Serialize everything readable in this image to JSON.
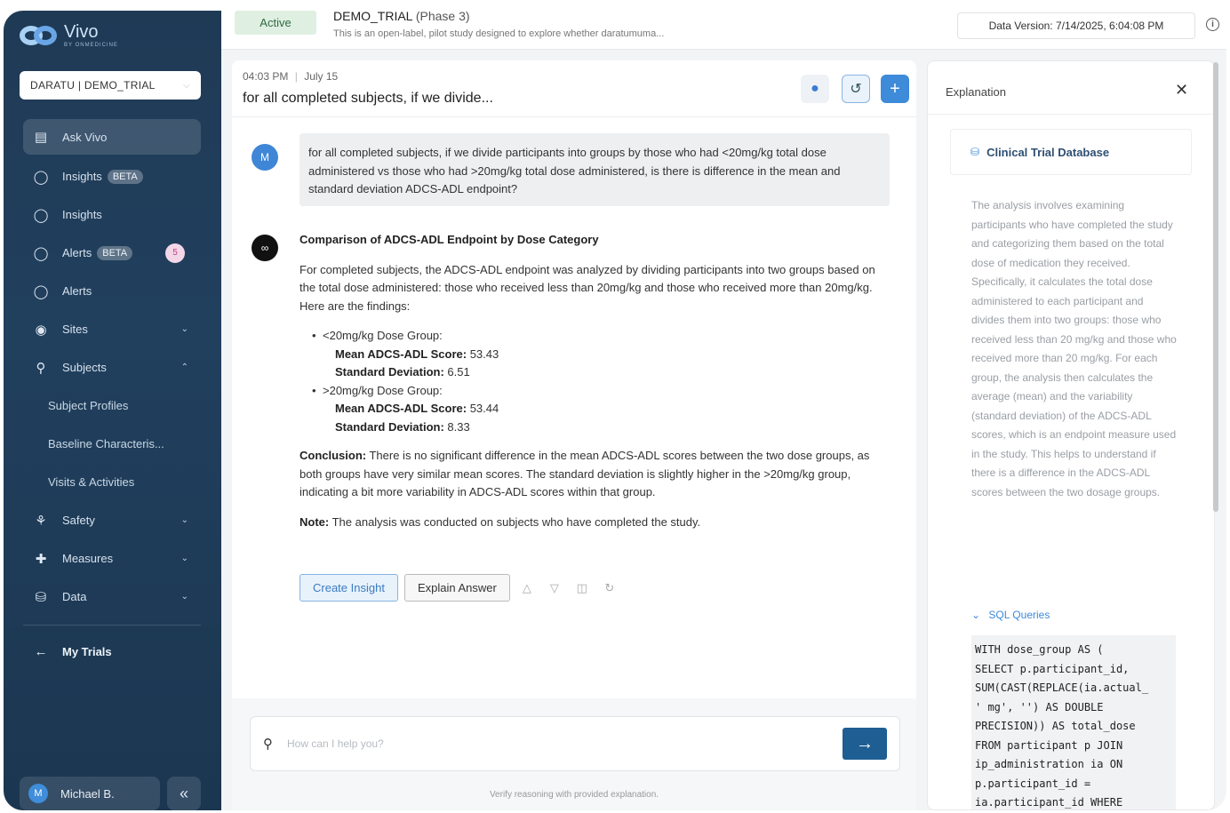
{
  "brand": {
    "name": "Vivo",
    "sub": "BY ONMEDICINE"
  },
  "trial_selector": {
    "value": "DARATU | DEMO_TRIAL"
  },
  "sidebar": {
    "items": [
      {
        "label": "Ask Vivo",
        "icon": "chat-icon"
      },
      {
        "label": "Insights",
        "icon": "lightbulb-icon",
        "badge": "BETA"
      },
      {
        "label": "Insights",
        "icon": "lightbulb-icon"
      },
      {
        "label": "Alerts",
        "icon": "shield-icon",
        "badge": "BETA",
        "count": "5"
      },
      {
        "label": "Alerts",
        "icon": "shield-icon"
      },
      {
        "label": "Sites",
        "icon": "location-icon"
      },
      {
        "label": "Subjects",
        "icon": "search-person-icon"
      }
    ],
    "subjects_children": [
      "Subject Profiles",
      "Baseline Characteris...",
      "Visits & Activities"
    ],
    "items_after": [
      {
        "label": "Safety",
        "icon": "hands-icon"
      },
      {
        "label": "Measures",
        "icon": "medkit-icon"
      },
      {
        "label": "Data",
        "icon": "database-icon"
      }
    ],
    "my_trials": "My Trials",
    "user": {
      "initial": "M",
      "name": "Michael B."
    }
  },
  "header": {
    "status": "Active",
    "study_name": "DEMO_TRIAL",
    "phase": "(Phase 3)",
    "description": "This is an open-label, pilot study designed to explore whether daratumuma...",
    "data_version": "Data Version: 7/14/2025, 6:04:08 PM"
  },
  "chat": {
    "time": "04:03 PM",
    "date": "July 15",
    "title": "for all completed subjects, if we divide...",
    "user_initial": "M",
    "user_message": "for all completed subjects, if we divide participants into groups by those who had <20mg/kg total dose administered vs those who had >20mg/kg total dose administered, is there is difference in the mean and standard deviation ADCS-ADL endpoint?",
    "answer": {
      "heading": "Comparison of ADCS-ADL Endpoint by Dose Category",
      "intro": "For completed subjects, the ADCS-ADL endpoint was analyzed by dividing participants into two groups based on the total dose administered: those who received less than 20mg/kg and those who received more than 20mg/kg. Here are the findings:",
      "groups": [
        {
          "name": "<20mg/kg Dose Group:",
          "mean_label": "Mean ADCS-ADL Score:",
          "mean": "53.43",
          "sd_label": "Standard Deviation:",
          "sd": "6.51"
        },
        {
          "name": ">20mg/kg Dose Group:",
          "mean_label": "Mean ADCS-ADL Score:",
          "mean": "53.44",
          "sd_label": "Standard Deviation:",
          "sd": "8.33"
        }
      ],
      "conclusion_label": "Conclusion:",
      "conclusion": " There is no significant difference in the mean ADCS-ADL scores between the two dose groups, as both groups have very similar mean scores. The standard deviation is slightly higher in the >20mg/kg group, indicating a bit more variability in ADCS-ADL scores within that group.",
      "note_label": "Note:",
      "note": " The analysis was conducted on subjects who have completed the study."
    },
    "actions": {
      "create_insight": "Create Insight",
      "explain_answer": "Explain Answer"
    },
    "input_placeholder": "How can I help you?",
    "verify_text": "Verify reasoning with provided explanation."
  },
  "explanation": {
    "title": "Explanation",
    "source": "Clinical Trial Database",
    "body": "The analysis involves examining participants who have completed the study and categorizing them based on the total dose of medication they received. Specifically, it calculates the total dose administered to each participant and divides them into two groups: those who received less than 20 mg/kg and those who received more than 20 mg/kg. For each group, the analysis then calculates the average (mean) and the variability (standard deviation) of the ADCS-ADL scores, which is an endpoint measure used in the study. This helps to understand if there is a difference in the ADCS-ADL scores between the two dosage groups.",
    "sql_label": "SQL Queries",
    "sql": "WITH dose_group AS (\nSELECT p.participant_id,\nSUM(CAST(REPLACE(ia.actual_\n' mg', '') AS DOUBLE\nPRECISION)) AS total_dose\nFROM participant p JOIN\nip_administration ia ON\np.participant_id =\nia.participant_id WHERE"
  },
  "colors": {
    "sidebar": "#1f3a55",
    "accent": "#3d8bd9",
    "send": "#1f5e93",
    "active_badge": "#dff0e3"
  }
}
